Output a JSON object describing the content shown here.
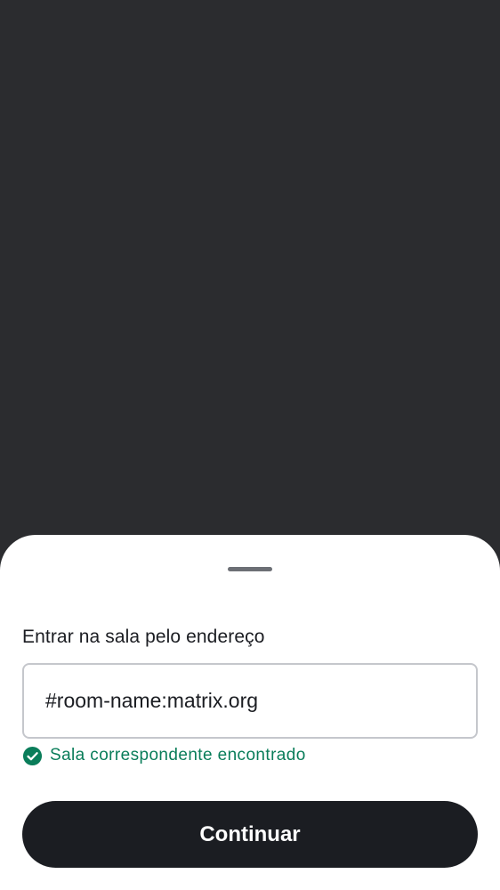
{
  "sheet": {
    "label": "Entrar na sala pelo endereço",
    "address_input": {
      "value": "#room-name:matrix.org",
      "placeholder": ""
    },
    "status": {
      "icon": "check-circle-icon",
      "text": "Sala correspondente encontrado",
      "color": "#0a7d5a"
    },
    "continue_label": "Continuar"
  },
  "colors": {
    "scrim": "#2b2c2f",
    "sheet_background": "#ffffff",
    "primary_button": "#1b1d22",
    "success": "#0a7d5a"
  }
}
